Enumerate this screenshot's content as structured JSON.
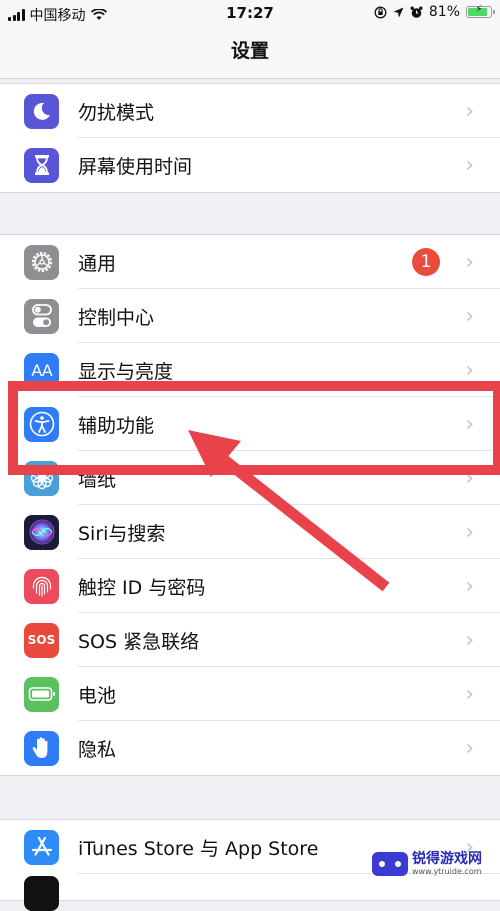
{
  "status_bar": {
    "carrier": "中国移动",
    "time": "17:27",
    "battery_percent": "81%",
    "battery_level": 0.81,
    "icons": [
      "signal-icon",
      "wifi-icon",
      "orientation-lock-icon",
      "location-icon",
      "alarm-icon",
      "battery-charging-icon"
    ]
  },
  "nav": {
    "title": "设置"
  },
  "groups": [
    {
      "items": [
        {
          "label": "勿扰模式",
          "icon": "moon-icon",
          "color": "#5856d6"
        },
        {
          "label": "屏幕使用时间",
          "icon": "hourglass-icon",
          "color": "#5856d6"
        }
      ]
    },
    {
      "items": [
        {
          "label": "通用",
          "icon": "gear-icon",
          "color": "#8e8e93",
          "badge": "1"
        },
        {
          "label": "控制中心",
          "icon": "toggles-icon",
          "color": "#8e8e93"
        },
        {
          "label": "显示与亮度",
          "icon": "text-size-icon",
          "color": "#2f7cf6",
          "glyph": "AA"
        },
        {
          "label": "辅助功能",
          "icon": "accessibility-icon",
          "color": "#2f7cf6"
        },
        {
          "label": "墙纸",
          "icon": "flower-icon",
          "color": "#4a9fd8"
        },
        {
          "label": "Siri与搜索",
          "icon": "siri-icon",
          "color": "#1b1b3a"
        },
        {
          "label": "触控 ID 与密码",
          "icon": "fingerprint-icon",
          "color": "#ec4b5e"
        },
        {
          "label": "SOS 紧急联络",
          "icon": "sos-icon",
          "color": "#e8493d",
          "glyph": "SOS"
        },
        {
          "label": "电池",
          "icon": "battery-icon",
          "color": "#5bc160"
        },
        {
          "label": "隐私",
          "icon": "hand-icon",
          "color": "#2f7cf6"
        }
      ]
    },
    {
      "items": [
        {
          "label": "iTunes Store 与 App Store",
          "icon": "app-store-icon",
          "color": "#2f8cf6"
        }
      ]
    }
  ],
  "annotation": {
    "highlighted_item": "辅助功能",
    "color": "#e8434b"
  },
  "watermark": {
    "title": "锐得游戏网",
    "url": "www.ytruide.com"
  }
}
